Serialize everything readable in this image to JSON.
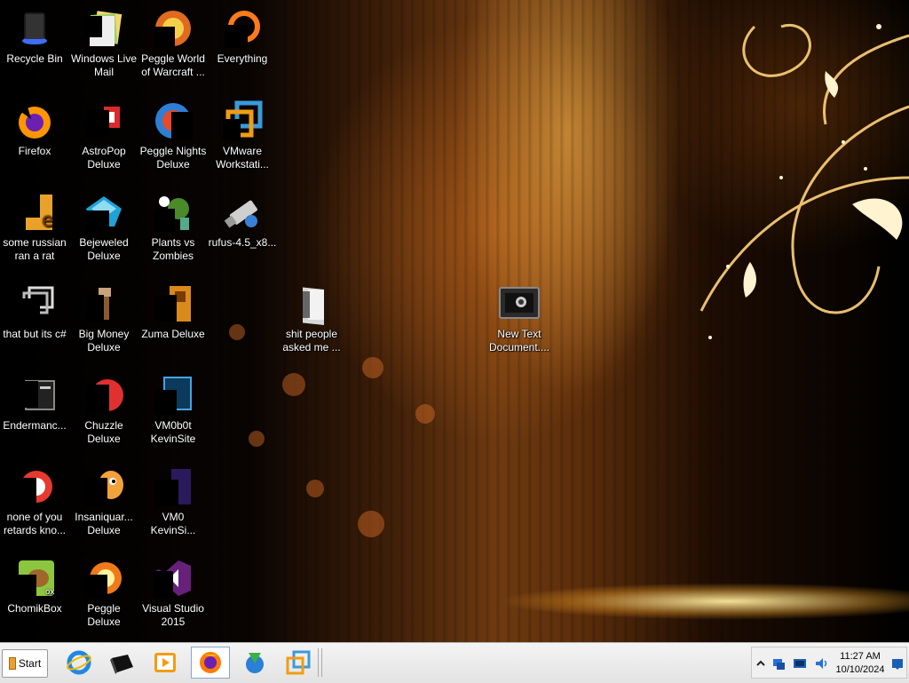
{
  "desktop_icons": [
    {
      "label": "Recycle Bin",
      "icon": "recycle-bin-icon"
    },
    {
      "label": "Windows Live Mail",
      "icon": "windows-live-mail-icon"
    },
    {
      "label": "Peggle World of Warcraft ...",
      "icon": "peggle-wow-icon"
    },
    {
      "label": "Everything",
      "icon": "everything-search-icon"
    },
    {
      "label": "Firefox",
      "icon": "firefox-icon"
    },
    {
      "label": "AstroPop Deluxe",
      "icon": "astropop-icon"
    },
    {
      "label": "Peggle Nights Deluxe",
      "icon": "peggle-nights-icon"
    },
    {
      "label": "VMware Workstati...",
      "icon": "vmware-icon"
    },
    {
      "label": "some russian ran a rat",
      "icon": "shortcut-e-icon"
    },
    {
      "label": "Bejeweled Deluxe",
      "icon": "bejeweled-icon"
    },
    {
      "label": "Plants vs Zombies",
      "icon": "plants-vs-zombies-icon"
    },
    {
      "label": "rufus-4.5_x8...",
      "icon": "rufus-usb-icon"
    },
    {
      "label": "that but its c#",
      "icon": "app-window-icon"
    },
    {
      "label": "Big Money Deluxe",
      "icon": "big-money-icon"
    },
    {
      "label": "Zuma Deluxe",
      "icon": "zuma-icon"
    },
    {
      "label": "shit people asked me ...",
      "icon": "folder-icon"
    },
    {
      "label": "New Text Document....",
      "icon": "text-document-icon"
    },
    {
      "label": "Endermanc...",
      "icon": "terminal-window-icon"
    },
    {
      "label": "Chuzzle Deluxe",
      "icon": "chuzzle-icon"
    },
    {
      "label": "VM0b0t KevinSite",
      "icon": "vm-shortcut-icon"
    },
    {
      "label": "none of you retards kno...",
      "icon": "red-circle-app-icon"
    },
    {
      "label": "Insaniquar... Deluxe",
      "icon": "insaniquarium-icon"
    },
    {
      "label": "VM0 KevinSi...",
      "icon": "vm-shortcut-2-icon"
    },
    {
      "label": "ChomikBox",
      "icon": "chomikbox-icon"
    },
    {
      "label": "Peggle Deluxe",
      "icon": "peggle-icon"
    },
    {
      "label": "Visual Studio 2015",
      "icon": "visual-studio-icon"
    }
  ],
  "taskbar": {
    "start_label": "Start",
    "pinned": [
      {
        "name": "internet-explorer",
        "icon": "ie-icon"
      },
      {
        "name": "terminal",
        "icon": "terminal-icon"
      },
      {
        "name": "media-player",
        "icon": "media-player-icon"
      },
      {
        "name": "firefox",
        "icon": "firefox-icon",
        "active": true
      },
      {
        "name": "download-manager",
        "icon": "download-manager-icon"
      },
      {
        "name": "vmware",
        "icon": "vmware-icon"
      }
    ]
  },
  "tray": {
    "time": "11:27 AM",
    "date": "10/10/2024",
    "icons": [
      "chevron-up-icon",
      "network-icon",
      "monitor-icon",
      "volume-icon"
    ]
  },
  "colors": {
    "taskbar_bg": "#eaeaea",
    "wallpaper_glow": "#ffb040"
  }
}
